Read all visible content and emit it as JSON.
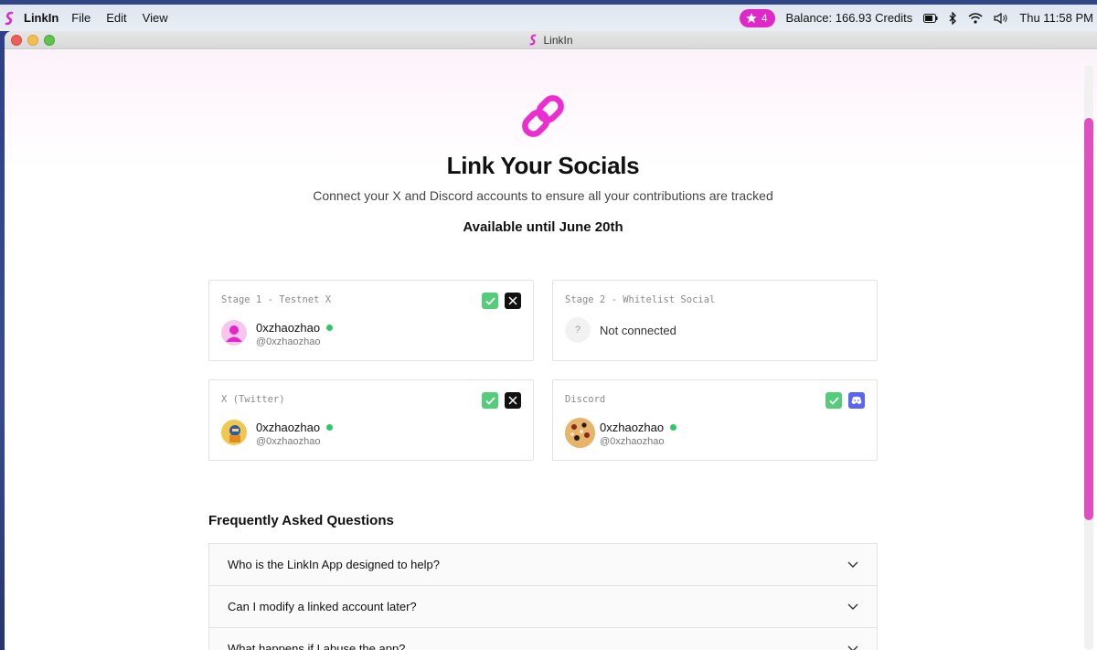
{
  "menubar": {
    "app_name": "LinkIn",
    "menus": [
      "File",
      "Edit",
      "View"
    ],
    "notifications": "4",
    "balance": "Balance:  166.93 Credits",
    "clock": "Thu 11:58 PM"
  },
  "window": {
    "title": "LinkIn"
  },
  "hero": {
    "title": "Link Your Socials",
    "subtitle": "Connect your X and Discord accounts to ensure all your contributions are tracked",
    "availability": "Available until June 20th"
  },
  "cards": [
    {
      "label": "Stage 1 - Testnet X",
      "username": "0xzhaozhao",
      "handle": "@0xzhaozhao",
      "badge": "x-icon"
    },
    {
      "label": "Stage 2 - Whitelist Social",
      "status": "Not connected",
      "placeholder": "?"
    },
    {
      "label": "X (Twitter)",
      "username": "0xzhaozhao",
      "handle": "@0xzhaozhao",
      "badge": "x-icon"
    },
    {
      "label": "Discord",
      "username": "0xzhaozhao",
      "handle": "@0xzhaozhao",
      "badge": "discord-icon"
    }
  ],
  "faq": {
    "title": "Frequently Asked Questions",
    "items": [
      "Who is the LinkIn App designed to help?",
      "Can I modify a linked account later?",
      "What happens if I abuse the app?"
    ]
  },
  "colors": {
    "brand": "#e028c8",
    "online": "#2ec866",
    "check": "#54cd7a",
    "discord": "#5865f2"
  }
}
